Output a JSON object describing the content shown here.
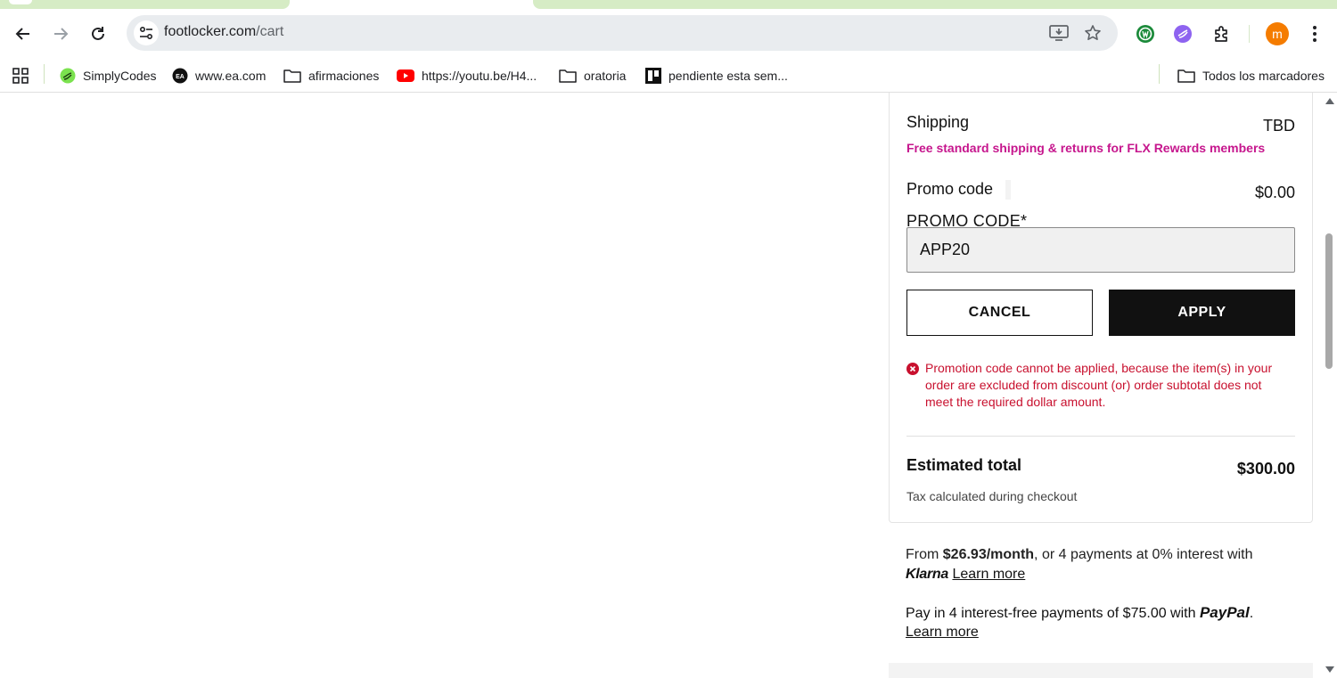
{
  "browser": {
    "url_domain": "footlocker.com",
    "url_path": "/cart",
    "avatar_letter": "m"
  },
  "bookmarks": {
    "items": [
      {
        "label": "SimplyCodes",
        "icon": "simplycodes-icon"
      },
      {
        "label": "www.ea.com",
        "icon": "ea-icon"
      },
      {
        "label": "afirmaciones",
        "icon": "folder-icon"
      },
      {
        "label": "https://youtu.be/H4...",
        "icon": "youtube-icon"
      },
      {
        "label": "oratoria",
        "icon": "folder-icon"
      },
      {
        "label": "pendiente esta sem...",
        "icon": "trello-icon"
      }
    ],
    "all_bookmarks": "Todos los marcadores"
  },
  "summary": {
    "shipping_label": "Shipping",
    "shipping_value": "TBD",
    "free_shipping_note": "Free standard shipping & returns for FLX Rewards members",
    "promo_label": "Promo code",
    "promo_value": "$0.00",
    "promo_field_label": "PROMO CODE*",
    "promo_input_value": "APP20",
    "cancel_label": "CANCEL",
    "apply_label": "APPLY",
    "error_message": "Promotion code cannot be applied, because the item(s) in your order are excluded from discount (or) order subtotal does not meet the required dollar amount.",
    "total_label": "Estimated total",
    "total_value": "$300.00",
    "tax_note": "Tax calculated during checkout"
  },
  "klarna": {
    "prefix": "From ",
    "monthly": "$26.93/month",
    "suffix": ", or 4 payments at 0% interest with",
    "logo": "Klarna",
    "learn_more": "Learn more"
  },
  "paypal": {
    "text": "Pay in 4 interest-free payments of $75.00 with ",
    "logo": "PayPal",
    "period": ".",
    "learn_more": "Learn more"
  },
  "colors": {
    "accent_magenta": "#c6168d",
    "error_red": "#c8102e",
    "apply_bg": "#111111"
  }
}
